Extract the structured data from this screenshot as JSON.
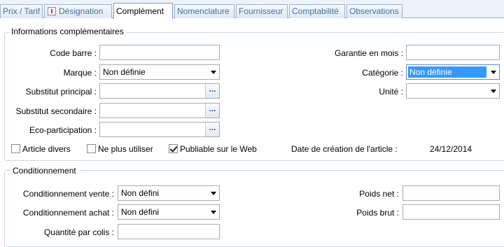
{
  "tabs": [
    {
      "label": "Prix / Tarif"
    },
    {
      "label": "Désignation"
    },
    {
      "label": "Complément"
    },
    {
      "label": "Nomenclature"
    },
    {
      "label": "Fournisseur"
    },
    {
      "label": "Comptabilité"
    },
    {
      "label": "Observations"
    }
  ],
  "info": {
    "title": "Informations complémentaires",
    "code_barre_label": "Code barre :",
    "code_barre_value": "",
    "marque_label": "Marque :",
    "marque_value": "Non définie",
    "substitut_principal_label": "Substitut principal :",
    "substitut_principal_value": "",
    "substitut_secondaire_label": "Substitut secondaire :",
    "substitut_secondaire_value": "",
    "eco_label": "Eco-participation :",
    "eco_value": "",
    "garantie_label": "Garantie en mois :",
    "garantie_value": "",
    "categorie_label": "Catégorie :",
    "categorie_value": "Non définie",
    "unite_label": "Unité :",
    "unite_value": "",
    "ellipsis": "...",
    "article_divers_label": "Article divers",
    "article_divers_checked": false,
    "ne_plus_utiliser_label": "Ne plus utiliser",
    "ne_plus_utiliser_checked": false,
    "publiable_label": "Publiable sur le Web",
    "publiable_checked": true,
    "date_creation_label": "Date de création de l'article :",
    "date_creation_value": "24/12/2014"
  },
  "conditionnement": {
    "title": "Conditionnement",
    "vente_label": "Conditionnement vente :",
    "vente_value": "Non défini",
    "achat_label": "Conditionnement achat :",
    "achat_value": "Non défini",
    "quantite_label": "Quantité par colis :",
    "quantite_value": "",
    "poids_net_label": "Poids net :",
    "poids_net_value": "",
    "poids_brut_label": "Poids brut :",
    "poids_brut_value": ""
  }
}
